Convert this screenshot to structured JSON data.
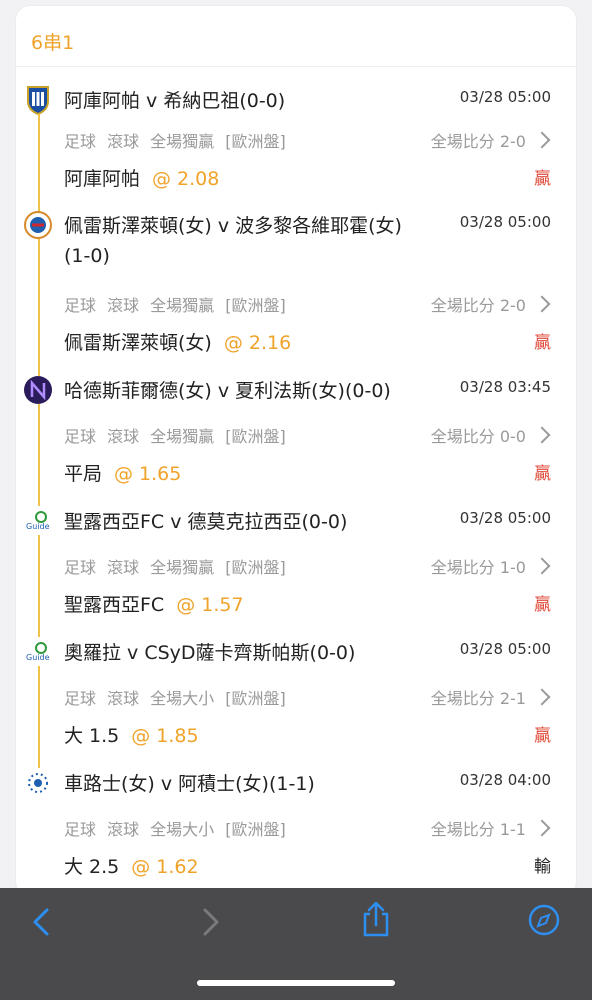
{
  "header": {
    "title": "6串1"
  },
  "bets": [
    {
      "match": "阿庫阿帕 v 希納巴祖(0-0)",
      "time": "03/28 05:00",
      "meta": "足球  滾球  全場獨贏  [歐洲盤]",
      "score": "全場比分 2-0",
      "pick": "阿庫阿帕",
      "odds": "@ 2.08",
      "result": "贏",
      "result_type": "win",
      "logo": "shield-logo"
    },
    {
      "match": "佩雷斯澤萊頓(女) v 波多黎各維耶霍(女)(1-0)",
      "time": "03/28 05:00",
      "meta": "足球  滾球  全場獨贏  [歐洲盤]",
      "score": "全場比分 2-0",
      "pick": "佩雷斯澤萊頓(女)",
      "odds": "@ 2.16",
      "result": "贏",
      "result_type": "win",
      "logo": "crest-logo"
    },
    {
      "match": "哈德斯菲爾德(女) v 夏利法斯(女)(0-0)",
      "time": "03/28 03:45",
      "meta": "足球  滾球  全場獨贏  [歐洲盤]",
      "score": "全場比分 0-0",
      "pick": "平局",
      "odds": "@ 1.65",
      "result": "贏",
      "result_type": "win",
      "logo": "n-logo"
    },
    {
      "match": "聖露西亞FC v 德莫克拉西亞(0-0)",
      "time": "03/28 05:00",
      "meta": "足球  滾球  全場獨贏  [歐洲盤]",
      "score": "全場比分 1-0",
      "pick": "聖露西亞FC",
      "odds": "@ 1.57",
      "result": "贏",
      "result_type": "win",
      "logo": "guide-logo"
    },
    {
      "match": "奧羅拉 v CSyD薩卡齊斯帕斯(0-0)",
      "time": "03/28 05:00",
      "meta": "足球  滾球  全場大小  [歐洲盤]",
      "score": "全場比分 2-1",
      "pick": "大 1.5",
      "odds": "@ 1.85",
      "result": "贏",
      "result_type": "win",
      "logo": "guide-logo"
    },
    {
      "match": "車路士(女) v 阿積士(女)(1-1)",
      "time": "03/28 04:00",
      "meta": "足球  滾球  全場大小  [歐洲盤]",
      "score": "全場比分 1-1",
      "pick": "大 2.5",
      "odds": "@ 1.62",
      "result": "輸",
      "result_type": "lose",
      "logo": "stars-logo"
    }
  ],
  "colors": {
    "accent": "#f0a32a",
    "win": "#e04b3b",
    "toolbar": "#4a4a4d",
    "link": "#2f8ff0"
  },
  "toolbar": [
    "back-icon",
    "forward-icon",
    "share-icon",
    "compass-icon"
  ]
}
